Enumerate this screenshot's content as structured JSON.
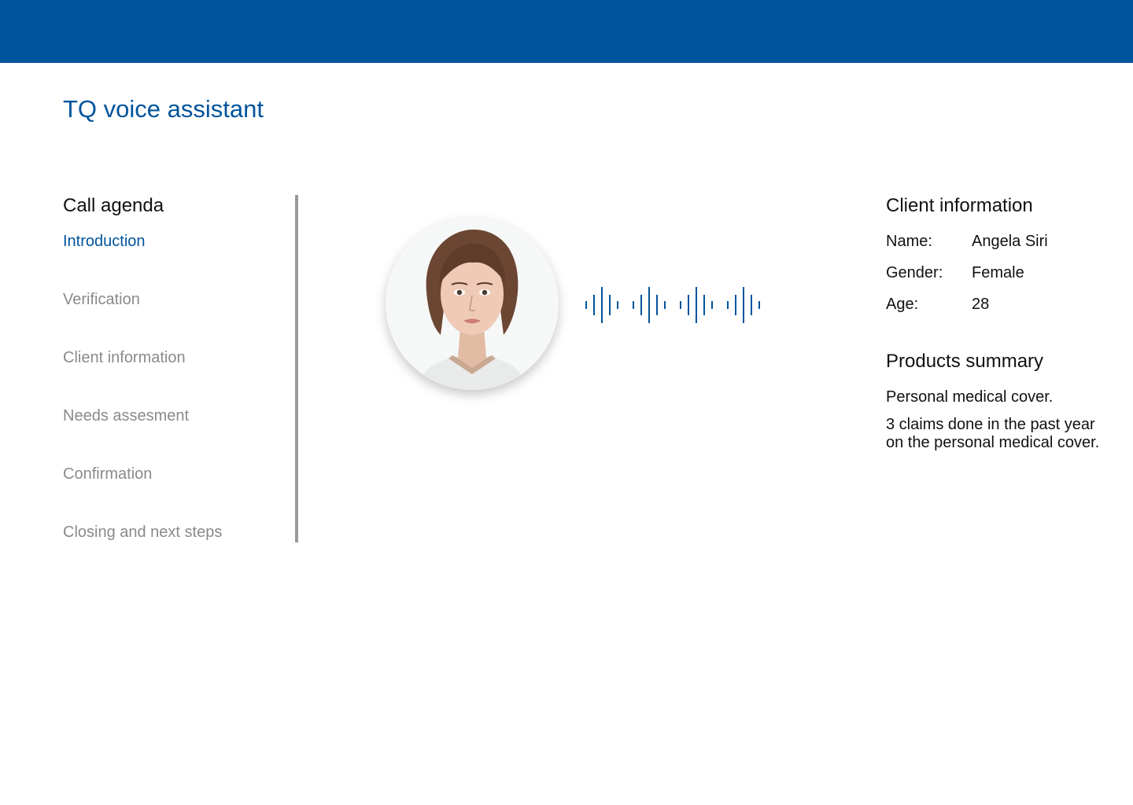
{
  "theme": {
    "brand_color": "#00549C",
    "muted_text_color": "#8A8A8A",
    "divider_color": "#9A9A9A"
  },
  "header": {
    "title": "TQ voice assistant"
  },
  "agenda": {
    "heading": "Call agenda",
    "items": [
      {
        "label": "Introduction",
        "active": true
      },
      {
        "label": "Verification",
        "active": false
      },
      {
        "label": "Client information",
        "active": false
      },
      {
        "label": "Needs assesment",
        "active": false
      },
      {
        "label": "Confirmation",
        "active": false
      },
      {
        "label": "Closing and next steps",
        "active": false
      }
    ]
  },
  "assistant": {
    "avatar_icon": "assistant-portrait",
    "speaking_indicator": "sound-wave-icon"
  },
  "client_info": {
    "heading": "Client information",
    "name_label": "Name:",
    "name_value": "Angela Siri",
    "gender_label": "Gender:",
    "gender_value": "Female",
    "age_label": "Age:",
    "age_value": "28"
  },
  "products": {
    "heading": "Products summary",
    "lines": [
      "Personal medical cover.",
      "3 claims done in the past year\non the personal medical cover."
    ],
    "line1": "Personal medical cover.",
    "line2a": "3 claims done in the past year",
    "line2b": "on the personal medical cover."
  }
}
